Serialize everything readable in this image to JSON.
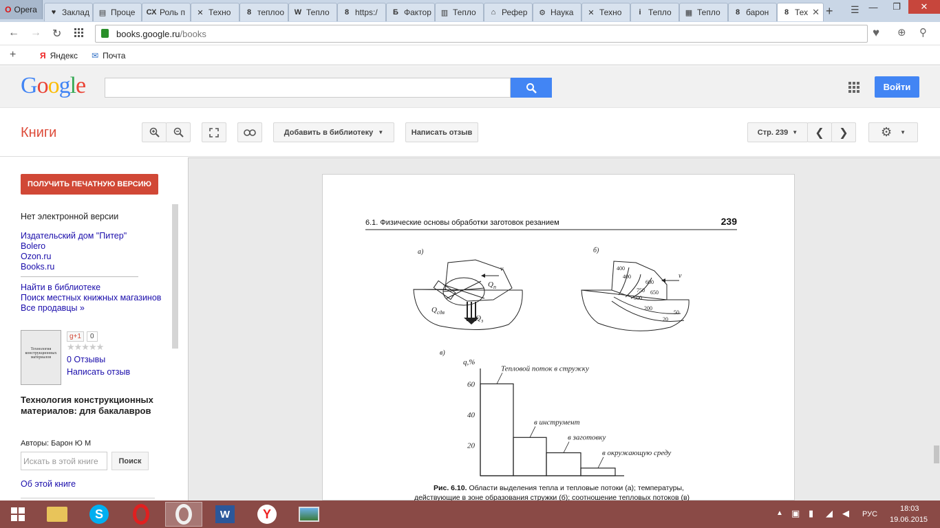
{
  "browser": {
    "menu_label": "Opera",
    "tabs": [
      {
        "label": "Заклад",
        "fav": "♥"
      },
      {
        "label": "Проце",
        "fav": "▤"
      },
      {
        "label": "Роль п",
        "fav": "СХ"
      },
      {
        "label": "Техно",
        "fav": "✕"
      },
      {
        "label": "теплоо",
        "fav": "8"
      },
      {
        "label": "Тепло",
        "fav": "W"
      },
      {
        "label": "https:/",
        "fav": "8"
      },
      {
        "label": "Фактор",
        "fav": "Б"
      },
      {
        "label": "Тепло",
        "fav": "▥"
      },
      {
        "label": "Рефер",
        "fav": "⌂"
      },
      {
        "label": "Наука",
        "fav": "⚙"
      },
      {
        "label": "Техно",
        "fav": "✕"
      },
      {
        "label": "Тепло",
        "fav": "i"
      },
      {
        "label": "Тепло",
        "fav": "▦"
      },
      {
        "label": "барон",
        "fav": "8"
      },
      {
        "label": "Тех",
        "fav": "8"
      }
    ],
    "url_domain": "books.google.ru",
    "url_path": "/books",
    "bookmarks": [
      {
        "label": "Яндекс"
      },
      {
        "label": "Почта"
      }
    ]
  },
  "google": {
    "logo": "Google",
    "signin_label": "Войти"
  },
  "toolbar": {
    "books_title": "Книги",
    "add_library": "Добавить в библиотеку",
    "write_review": "Написать отзыв",
    "page_label": "Стр. 239"
  },
  "left": {
    "print_button": "ПОЛУЧИТЬ ПЕЧАТНУЮ ВЕРСИЮ",
    "no_ebook": "Нет электронной версии",
    "sellers": [
      "Издательский дом \"Питер\"",
      "Bolero",
      "Ozon.ru",
      "Books.ru"
    ],
    "find_library": "Найти в библиотеке",
    "find_local": "Поиск местных книжных магазинов",
    "all_sellers": "Все продавцы »",
    "gplus": "g+1",
    "gplus_count": "0",
    "reviews": "0 Отзывы",
    "write_review": "Написать отзыв",
    "cover_text": "Технология конструкционных материалов",
    "book_title": "Технология конструкционных материалов: для бакалавров",
    "authors": "Авторы: Барон Ю М",
    "search_placeholder": "Искать в этой книге",
    "search_button": "Поиск",
    "about": "Об этой книге"
  },
  "page": {
    "header": "6.1. Физические основы обработки заготовок резанием",
    "page_number": "239",
    "fig_a": "а)",
    "fig_b": "б)",
    "fig_v": "в)",
    "label_v": "v",
    "label_qp": "Q",
    "label_qp_sub": "п",
    "label_qsdv": "Q",
    "label_qsdv_sub": "сдв",
    "label_qz": "Q",
    "label_qz_sub": "з",
    "iso_labels": [
      "400",
      "400",
      "600",
      "750",
      "650",
      "500",
      "200",
      "50",
      "20"
    ],
    "caption_bold": "Рис. 6.10.",
    "caption_line1": " Области выделения тепла и тепловые потоки (а); температуры,",
    "caption_line2": "действующие в зоне образования стружки (б); соотношение тепловых потоков (в)"
  },
  "chart_data": {
    "type": "bar",
    "categories": [
      "Тепловой поток в стружку",
      "в инструмент",
      "в заготовку",
      "в окружающую среду"
    ],
    "values": [
      60,
      25,
      15,
      5
    ],
    "ylabel": "q,%",
    "yticks": [
      20,
      40,
      60
    ],
    "ylim": [
      0,
      70
    ]
  },
  "taskbar": {
    "lang": "РУС",
    "time": "18:03",
    "date": "19.06.2015"
  }
}
